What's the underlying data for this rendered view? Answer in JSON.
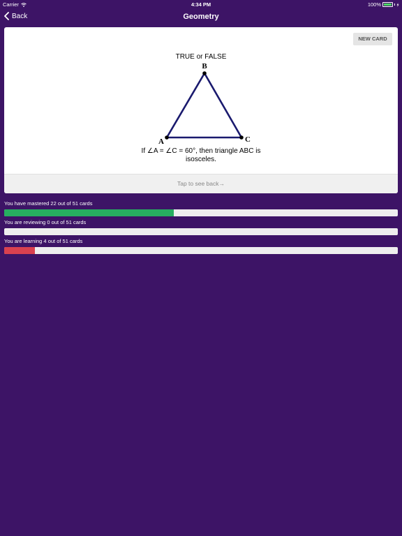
{
  "status_bar": {
    "carrier": "Carrier",
    "time": "4:34 PM",
    "battery": "100%"
  },
  "nav": {
    "back_label": "Back",
    "title": "Geometry"
  },
  "card": {
    "new_card_label": "NEW CARD",
    "question": "TRUE or FALSE",
    "vertex_a": "A",
    "vertex_b": "B",
    "vertex_c": "C",
    "caption_line1": "If ∠A = ∠C = 60°, then triangle ABC is",
    "caption_line2": "isosceles.",
    "footer": "Tap to see back→"
  },
  "progress": [
    {
      "label": "You have mastered 22 out of 51 cards",
      "fraction": 0.4314,
      "color": "#27ae60"
    },
    {
      "label": "You are reviewing 0 out of 51 cards",
      "fraction": 0,
      "color": "#f1c40f"
    },
    {
      "label": "You are learning 4 out of 51 cards",
      "fraction": 0.0784,
      "color": "#d9414f"
    }
  ],
  "colors": {
    "background": "#3d1466",
    "triangle": "#1a1a6e"
  },
  "icons": [
    "wifi-icon",
    "battery-icon",
    "chevron-left-icon"
  ]
}
